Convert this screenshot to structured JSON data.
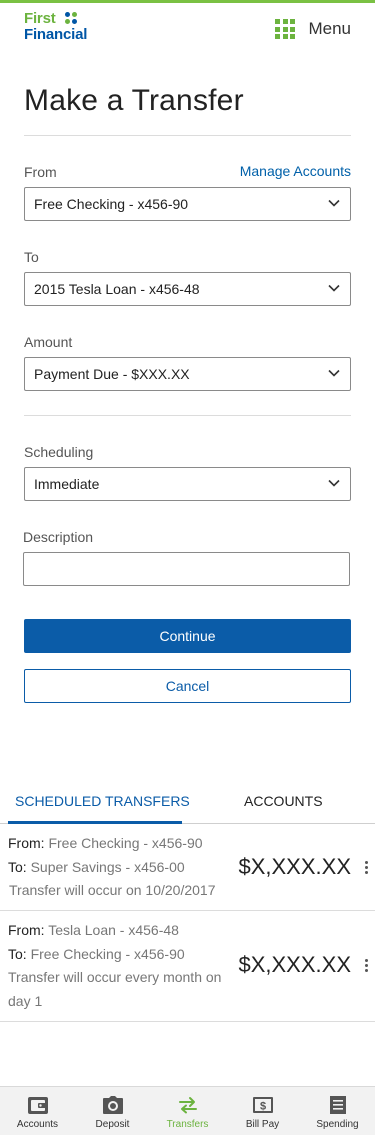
{
  "brand": {
    "line1": "First",
    "line2": "Financial"
  },
  "header": {
    "menu_label": "Menu"
  },
  "page": {
    "title": "Make a Transfer"
  },
  "form": {
    "from": {
      "label": "From",
      "value": "Free Checking - x456-90",
      "manage_link": "Manage Accounts"
    },
    "to": {
      "label": "To",
      "value": "2015 Tesla Loan - x456-48"
    },
    "amount": {
      "label": "Amount",
      "value": "Payment Due - $XXX.XX"
    },
    "scheduling": {
      "label": "Scheduling",
      "value": "Immediate"
    },
    "description": {
      "label": "Description",
      "value": "",
      "placeholder": ""
    }
  },
  "actions": {
    "continue_label": "Continue",
    "cancel_label": "Cancel"
  },
  "tabs": [
    {
      "label": "SCHEDULED TRANSFERS",
      "active": true
    },
    {
      "label": "ACCOUNTS",
      "active": false
    }
  ],
  "scheduled_transfers": [
    {
      "from_label": "From:",
      "from_value": "Free Checking - x456-90",
      "to_label": "To:",
      "to_value": "Super Savings - x456-00",
      "note": "Transfer will occur on 10/20/2017",
      "amount": "$X,XXX.XX"
    },
    {
      "from_label": "From:",
      "from_value": "Tesla Loan - x456-48",
      "to_label": "To:",
      "to_value": "Free Checking - x456-90",
      "note": "Transfer will occur every month on day 1",
      "amount": "$X,XXX.XX"
    }
  ],
  "bottom_nav": [
    {
      "label": "Accounts",
      "icon": "wallet-icon",
      "active": false
    },
    {
      "label": "Deposit",
      "icon": "camera-icon",
      "active": false
    },
    {
      "label": "Transfers",
      "icon": "transfer-arrows-icon",
      "active": true
    },
    {
      "label": "Bill Pay",
      "icon": "dollar-bill-icon",
      "active": false
    },
    {
      "label": "Spending",
      "icon": "receipt-icon",
      "active": false
    }
  ],
  "colors": {
    "brand_green": "#6cb33f",
    "brand_blue": "#0b5ca8",
    "link_blue": "#0060a9"
  }
}
